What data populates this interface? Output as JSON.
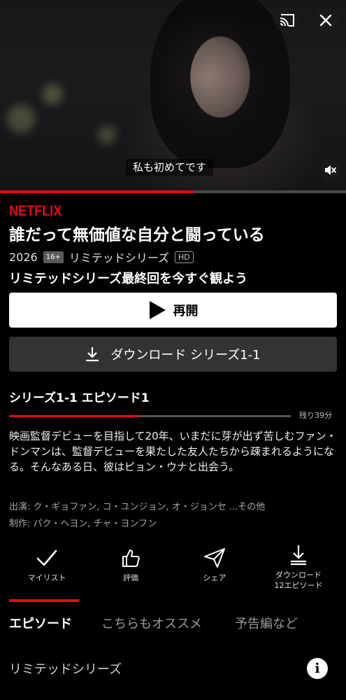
{
  "player": {
    "subtitle_text": "私も初めてです",
    "video_progress_percent": 56
  },
  "brand": {
    "logo_text": "NETFLIX",
    "color": "#e50914"
  },
  "show": {
    "title": "誰だって無価値な自分と闘っている",
    "year": "2026",
    "rating": "16+",
    "type": "リミテッドシリーズ",
    "quality": "HD",
    "promo": "リミテッドシリーズ最終回を今すぐ観よう"
  },
  "buttons": {
    "resume_label": "再開",
    "download_label": "ダウンロード シリーズ1-1"
  },
  "episode": {
    "heading": "シリーズ1-1 エピソード1",
    "progress_percent": 46,
    "remaining": "残り39分",
    "synopsis": "映画監督デビューを目指して20年、いまだに芽が出ず苦しむファン・ドンマンは、監督デビューを果たした友人たちから疎まれるようになる。そんなある日、彼はピョン・ウナと出会う。",
    "cast": "出演: ク・ギョファン, コ・ユンジョン, オ・ジョンセ ...その他",
    "creators": "制作: パク・ヘヨン, チャ・ヨンフン"
  },
  "actions": [
    {
      "label": "マイリスト",
      "icon": "check-icon"
    },
    {
      "label": "評価",
      "icon": "thumbs-up-icon"
    },
    {
      "label": "シェア",
      "icon": "send-icon"
    },
    {
      "label": "ダウンロード",
      "sublabel": "12エピソード",
      "icon": "download-icon"
    }
  ],
  "tabs": [
    {
      "label": "エピソード",
      "active": true
    },
    {
      "label": "こちらもオススメ",
      "active": false
    },
    {
      "label": "予告編など",
      "active": false
    }
  ],
  "season_selector": {
    "label": "リミテッドシリーズ"
  }
}
